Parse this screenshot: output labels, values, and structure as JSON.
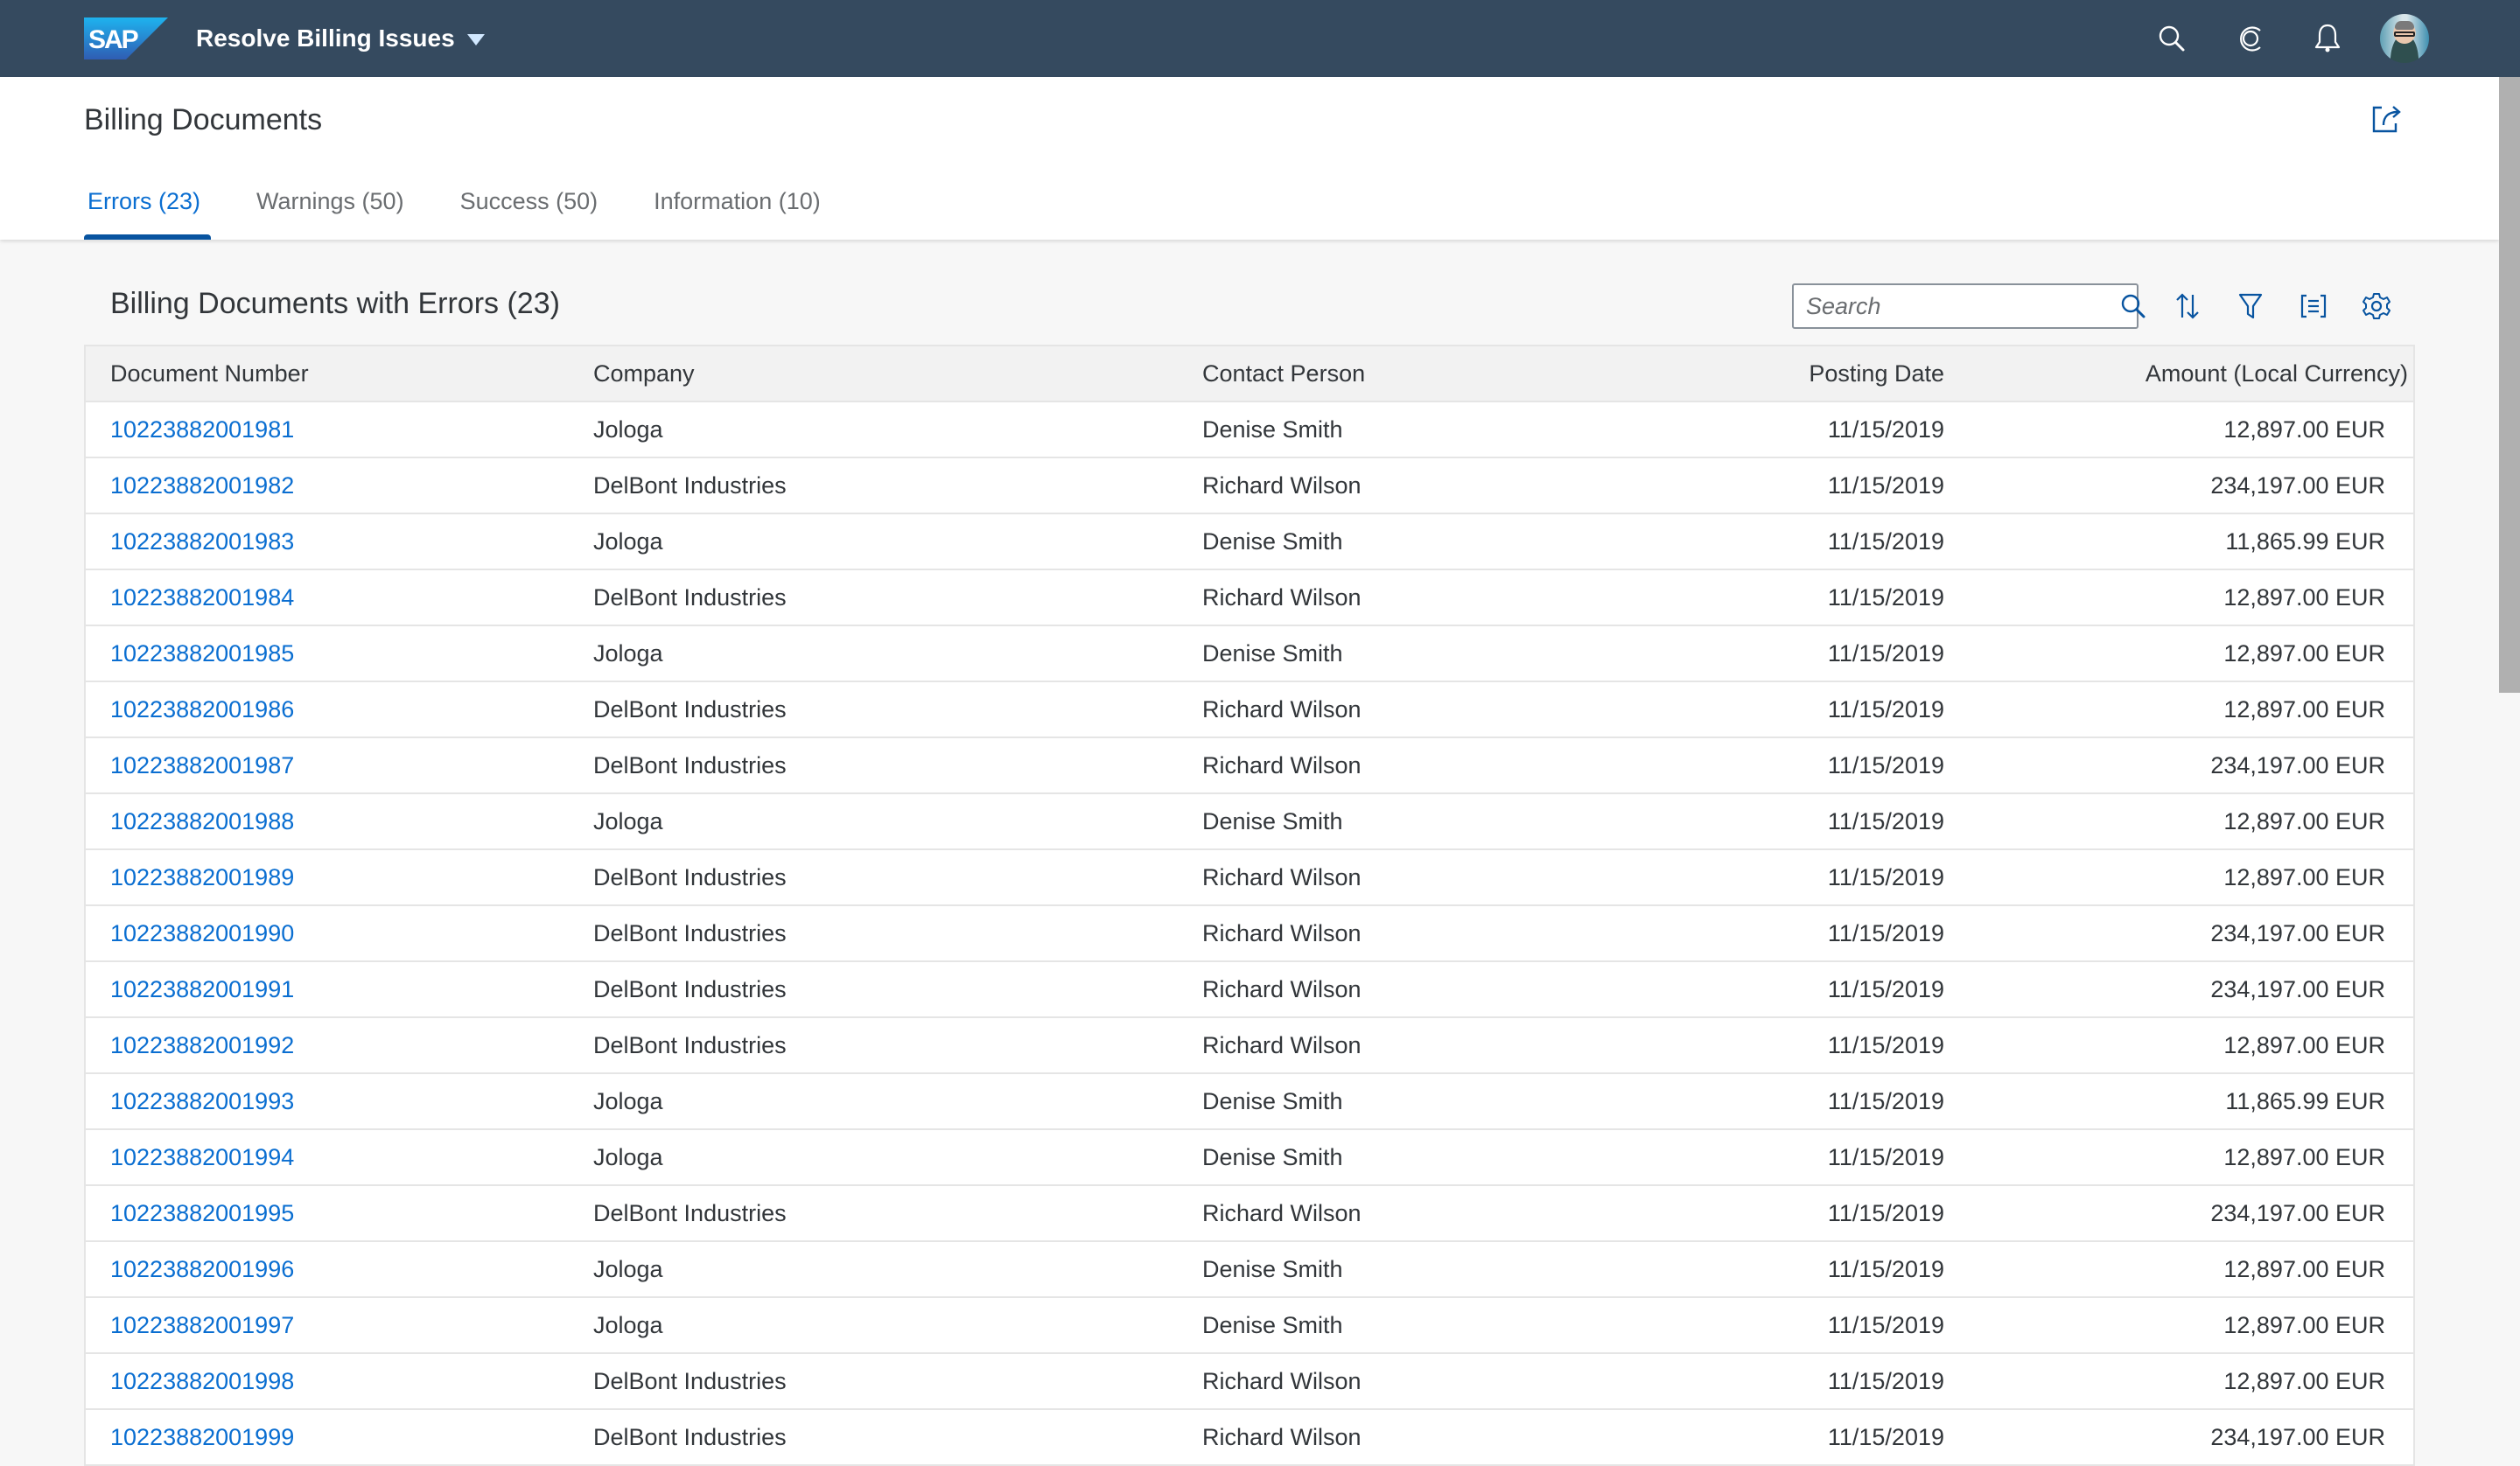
{
  "shell": {
    "logo_text": "SAP",
    "app_title": "Resolve Billing Issues",
    "icons": [
      "search-icon",
      "copilot-icon",
      "notifications-icon"
    ],
    "avatar_alt": "User avatar"
  },
  "page": {
    "title": "Billing Documents",
    "tabs": [
      {
        "label": "Errors (23)",
        "active": true
      },
      {
        "label": "Warnings (50)",
        "active": false
      },
      {
        "label": "Success (50)",
        "active": false
      },
      {
        "label": "Information (10)",
        "active": false
      }
    ]
  },
  "section": {
    "title": "Billing Documents with Errors (23)",
    "search_placeholder": "Search",
    "toolbar": [
      "sort-icon",
      "filter-icon",
      "group-icon",
      "settings-icon"
    ]
  },
  "table": {
    "columns": [
      "Document Number",
      "Company",
      "Contact Person",
      "Posting Date",
      "Amount (Local Currency)"
    ],
    "rows": [
      [
        "10223882001981",
        "Jologa",
        "Denise Smith",
        "11/15/2019",
        "12,897.00 EUR"
      ],
      [
        "10223882001982",
        "DelBont Industries",
        "Richard Wilson",
        "11/15/2019",
        "234,197.00 EUR"
      ],
      [
        "10223882001983",
        "Jologa",
        "Denise Smith",
        "11/15/2019",
        "11,865.99 EUR"
      ],
      [
        "10223882001984",
        "DelBont Industries",
        "Richard Wilson",
        "11/15/2019",
        "12,897.00 EUR"
      ],
      [
        "10223882001985",
        "Jologa",
        "Denise Smith",
        "11/15/2019",
        "12,897.00 EUR"
      ],
      [
        "10223882001986",
        "DelBont Industries",
        "Richard Wilson",
        "11/15/2019",
        "12,897.00 EUR"
      ],
      [
        "10223882001987",
        "DelBont Industries",
        "Richard Wilson",
        "11/15/2019",
        "234,197.00 EUR"
      ],
      [
        "10223882001988",
        "Jologa",
        "Denise Smith",
        "11/15/2019",
        "12,897.00 EUR"
      ],
      [
        "10223882001989",
        "DelBont Industries",
        "Richard Wilson",
        "11/15/2019",
        "12,897.00 EUR"
      ],
      [
        "10223882001990",
        "DelBont Industries",
        "Richard Wilson",
        "11/15/2019",
        "234,197.00 EUR"
      ],
      [
        "10223882001991",
        "DelBont Industries",
        "Richard Wilson",
        "11/15/2019",
        "234,197.00 EUR"
      ],
      [
        "10223882001992",
        "DelBont Industries",
        "Richard Wilson",
        "11/15/2019",
        "12,897.00 EUR"
      ],
      [
        "10223882001993",
        "Jologa",
        "Denise Smith",
        "11/15/2019",
        "11,865.99 EUR"
      ],
      [
        "10223882001994",
        "Jologa",
        "Denise Smith",
        "11/15/2019",
        "12,897.00 EUR"
      ],
      [
        "10223882001995",
        "DelBont Industries",
        "Richard Wilson",
        "11/15/2019",
        "234,197.00 EUR"
      ],
      [
        "10223882001996",
        "Jologa",
        "Denise Smith",
        "11/15/2019",
        "12,897.00 EUR"
      ],
      [
        "10223882001997",
        "Jologa",
        "Denise Smith",
        "11/15/2019",
        "12,897.00 EUR"
      ],
      [
        "10223882001998",
        "DelBont Industries",
        "Richard Wilson",
        "11/15/2019",
        "12,897.00 EUR"
      ],
      [
        "10223882001999",
        "DelBont Industries",
        "Richard Wilson",
        "11/15/2019",
        "234,197.00 EUR"
      ]
    ]
  },
  "colors": {
    "shell_bg": "#354a5f",
    "accent": "#0a6ed1",
    "tab_underline": "#0854a0",
    "text": "#32363a",
    "muted_text": "#6a6d70",
    "page_bg": "#f7f7f7"
  }
}
